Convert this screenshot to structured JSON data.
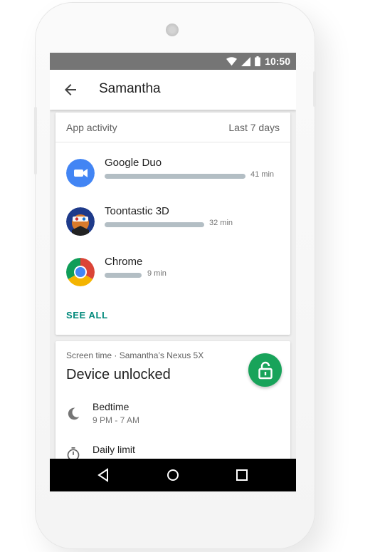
{
  "status_bar": {
    "time": "10:50",
    "icons": [
      "wifi-icon",
      "signal-icon",
      "battery-icon"
    ]
  },
  "app_bar": {
    "back_icon": "arrow-back-icon",
    "title": "Samantha"
  },
  "app_activity": {
    "header": "App activity",
    "period": "Last 7 days",
    "apps": [
      {
        "name": "Google Duo",
        "time": "41 min",
        "icon": "google-duo-icon"
      },
      {
        "name": "Toontastic 3D",
        "time": "32 min",
        "icon": "toontastic-icon"
      },
      {
        "name": "Chrome",
        "time": "9 min",
        "icon": "chrome-icon"
      }
    ],
    "see_all": "SEE ALL"
  },
  "screen_time": {
    "label": "Screen time · Samantha’s Nexus 5X",
    "status": "Device unlocked",
    "fab_icon": "lock-open-icon",
    "schedule": [
      {
        "name": "Bedtime",
        "time": "9 PM - 7 AM",
        "icon": "moon-icon"
      },
      {
        "name": "Daily limit",
        "time": "",
        "icon": "timer-icon"
      }
    ]
  },
  "colors": {
    "accent": "#00897b",
    "fab": "#18a35a",
    "status_bar": "#757575",
    "usage_bar": "#b3bec4"
  },
  "nav_bar": [
    "back-triangle-icon",
    "home-circle-icon",
    "recents-square-icon"
  ]
}
